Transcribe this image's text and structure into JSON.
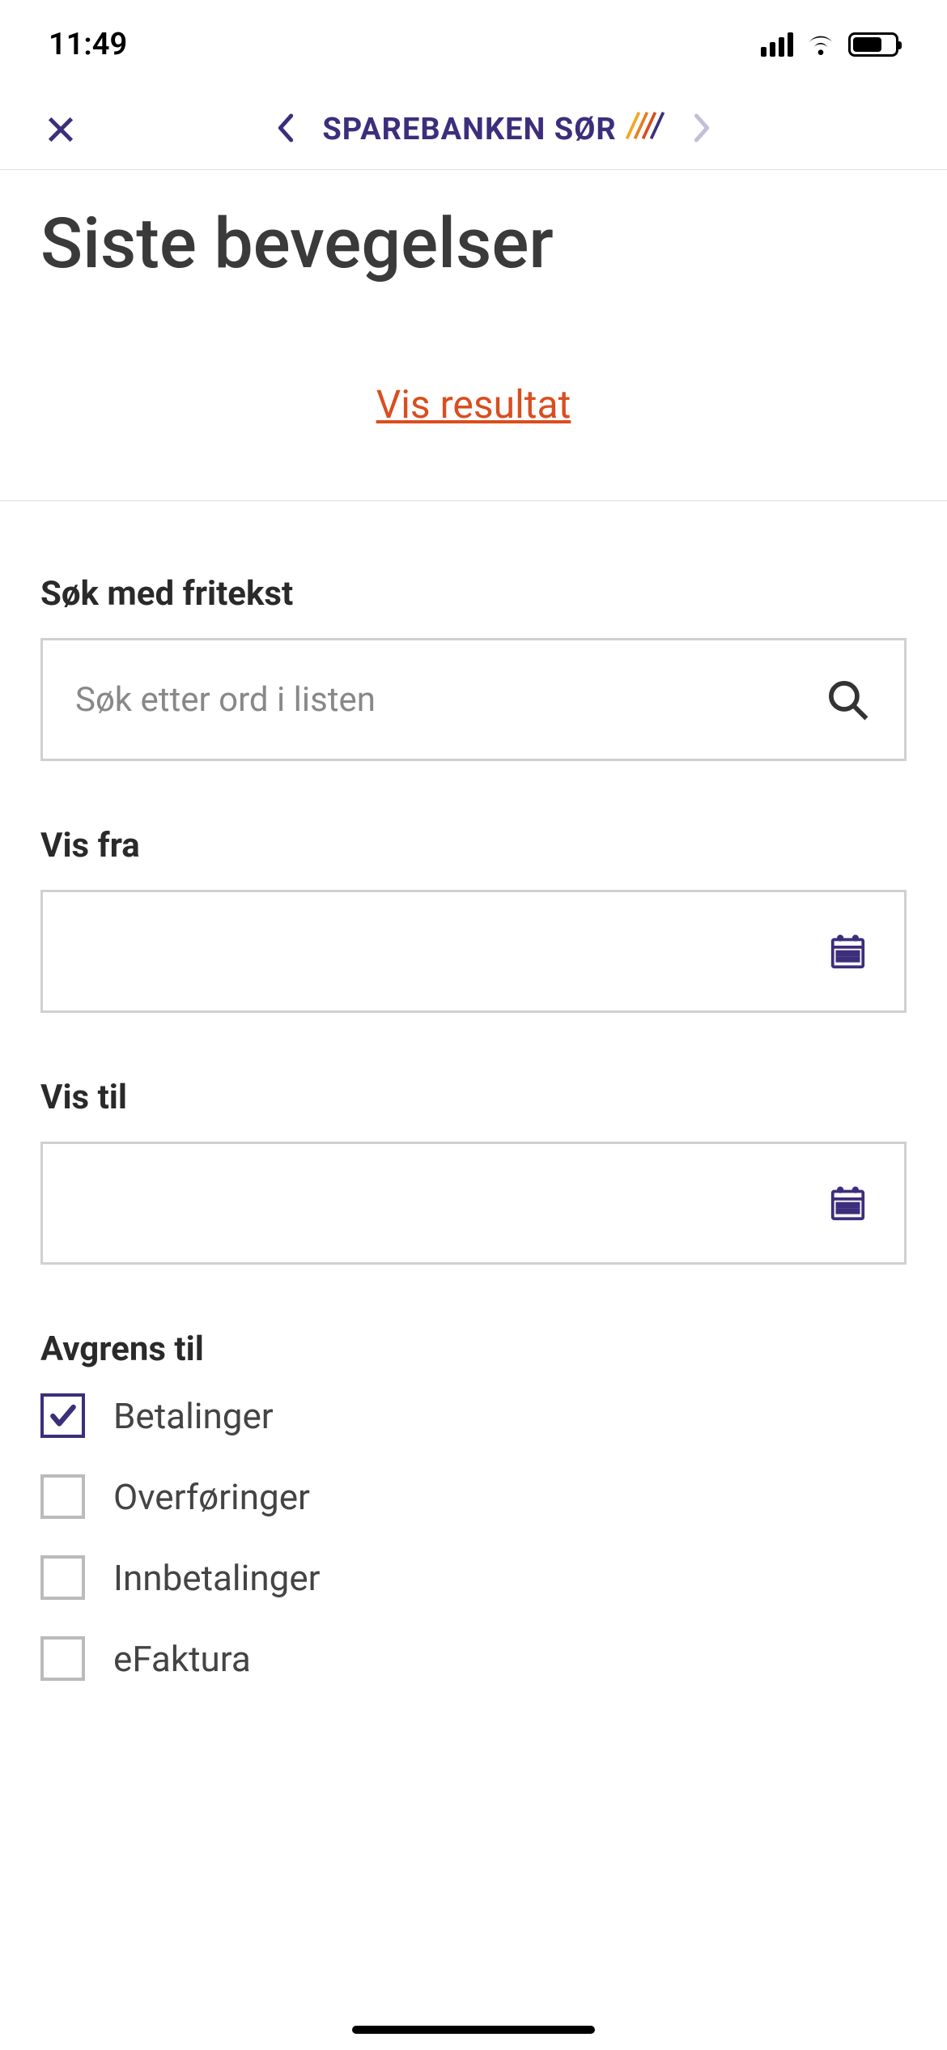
{
  "statusBar": {
    "time": "11:49"
  },
  "navBar": {
    "title": "SPAREBANKEN SØR"
  },
  "page": {
    "title": "Siste bevegelser",
    "resultLink": "Vis resultat"
  },
  "search": {
    "label": "Søk med fritekst",
    "placeholder": "Søk etter ord i listen"
  },
  "dateFrom": {
    "label": "Vis fra"
  },
  "dateTo": {
    "label": "Vis til"
  },
  "filter": {
    "label": "Avgrens til",
    "options": [
      {
        "label": "Betalinger",
        "checked": true
      },
      {
        "label": "Overføringer",
        "checked": false
      },
      {
        "label": "Innbetalinger",
        "checked": false
      },
      {
        "label": "eFaktura",
        "checked": false
      }
    ]
  }
}
